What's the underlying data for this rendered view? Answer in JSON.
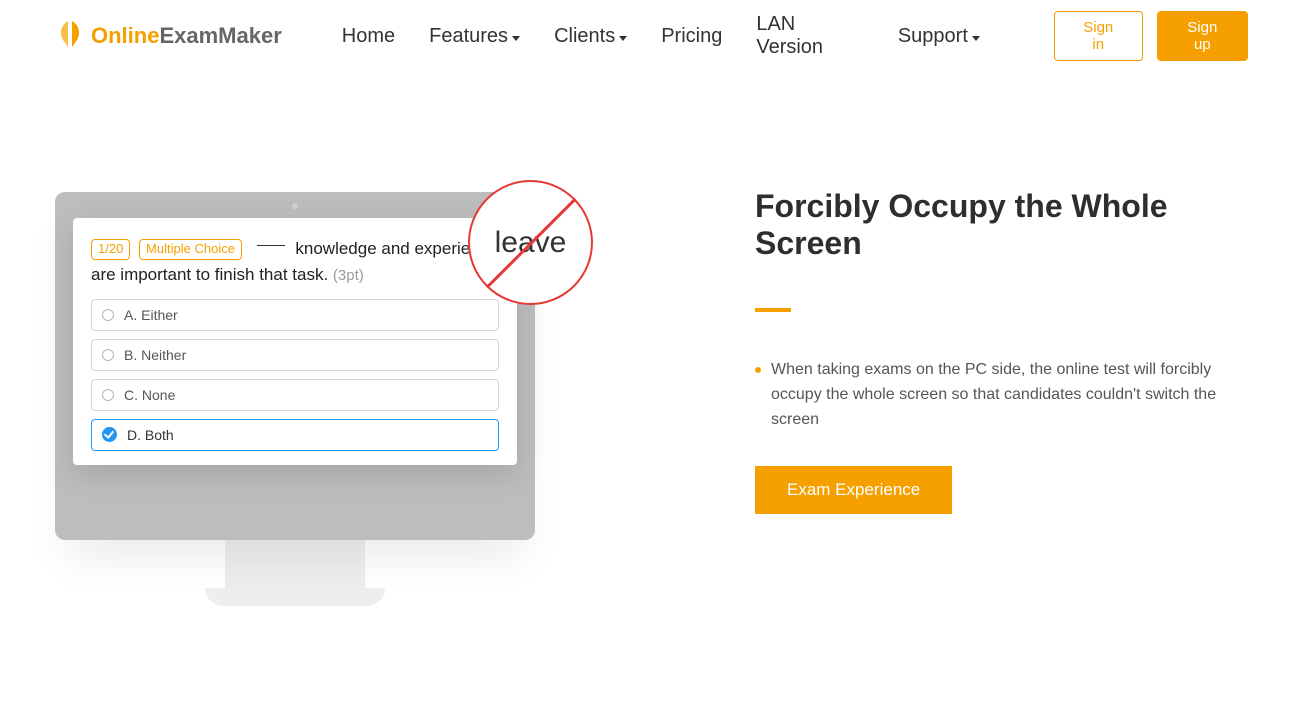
{
  "brand": {
    "name_a": "Online",
    "name_b": "ExamMaker"
  },
  "nav": {
    "items": [
      {
        "label": "Home",
        "dropdown": false
      },
      {
        "label": "Features",
        "dropdown": true
      },
      {
        "label": "Clients",
        "dropdown": true
      },
      {
        "label": "Pricing",
        "dropdown": false
      },
      {
        "label": "LAN Version",
        "dropdown": false
      },
      {
        "label": "Support",
        "dropdown": true
      }
    ],
    "signin": "Sign in",
    "signup": "Sign up"
  },
  "exam": {
    "progress_pill": "1/20",
    "type_pill": "Multiple Choice",
    "question_tail": "knowledge and experience are important to finish that task.",
    "points": "(3pt)",
    "options": [
      {
        "label": "A. Either",
        "selected": false
      },
      {
        "label": "B. Neither",
        "selected": false
      },
      {
        "label": "C. None",
        "selected": false
      },
      {
        "label": "D. Both",
        "selected": true
      }
    ],
    "leave_text": "leave"
  },
  "section": {
    "title": "Forcibly Occupy the Whole Screen",
    "bullets": [
      "When taking exams on the PC side, the online test will forcibly occupy the whole screen so that candidates couldn't switch the screen"
    ],
    "cta": "Exam Experience"
  },
  "colors": {
    "accent": "#f6a000",
    "danger": "#e53935",
    "selected": "#2196f3"
  }
}
